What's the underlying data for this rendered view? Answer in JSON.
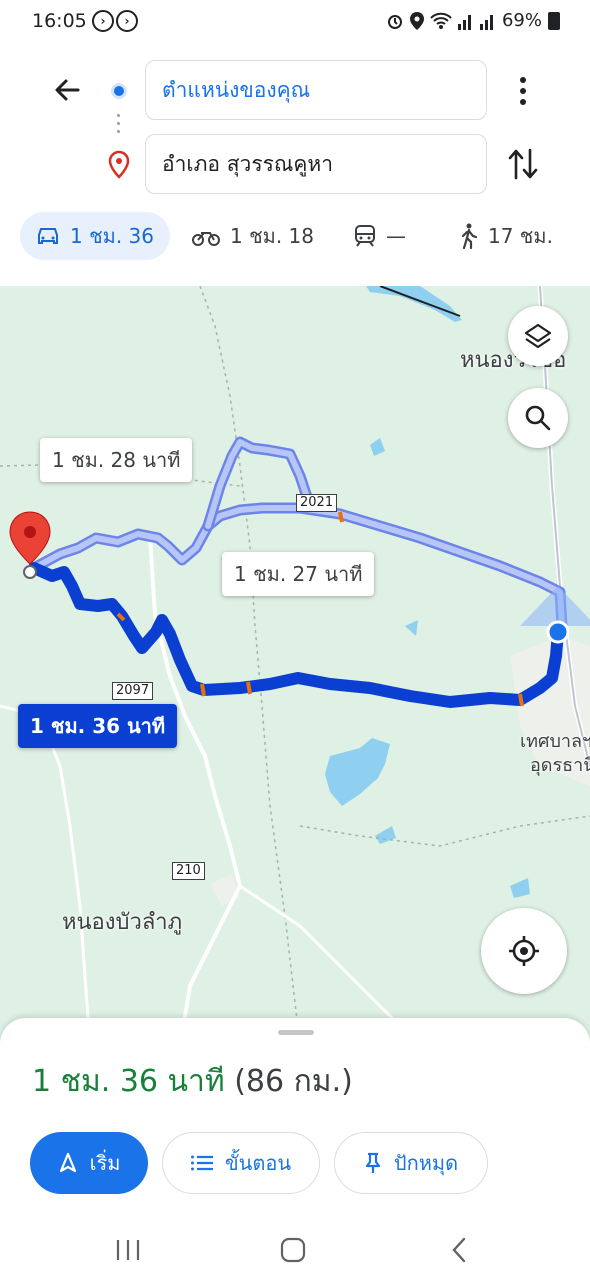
{
  "status_bar": {
    "time": "16:05",
    "battery": "69%",
    "icons": [
      "media-icon",
      "media-icon",
      "alarm-icon",
      "location-icon",
      "wifi-icon",
      "signal-icon",
      "signal-icon",
      "battery-icon"
    ]
  },
  "directions": {
    "origin": "ตำแหน่งของคุณ",
    "destination": "อำเภอ สุวรรณคูหา"
  },
  "modes": [
    {
      "name": "car",
      "label": "1 ชม. 36",
      "active": true
    },
    {
      "name": "motorbike",
      "label": "1 ชม. 18",
      "active": false
    },
    {
      "name": "transit",
      "label": "—",
      "active": false
    },
    {
      "name": "walk",
      "label": "17 ชม.",
      "active": false
    }
  ],
  "map": {
    "route_callouts": {
      "alt1": "1 ชม. 28 นาที",
      "alt2": "1 ชม. 27 นาที",
      "selected": "1 ชม. 36 นาที"
    },
    "road_shields": [
      "2021",
      "2097",
      "210"
    ],
    "places": {
      "top_right": "หนองวัวซอ",
      "city_right_1": "เทศบาลฯ",
      "city_right_2": "อุดรธานี",
      "bottom_left": "หนองบัวลำภู"
    },
    "colors": {
      "selected_route": "#0b3fd1",
      "alt_route": "#a9b8f5",
      "land": "#dff0e4",
      "water": "#8fd0f0"
    }
  },
  "sheet": {
    "time": "1 ชม. 36 นาที",
    "distance": "(86 กม.)",
    "start_label": "เริ่ม",
    "steps_label": "ขั้นตอน",
    "pin_label": "ปักหมุด"
  }
}
